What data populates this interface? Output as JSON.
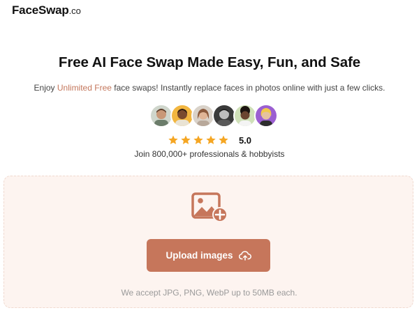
{
  "header": {
    "logo_main": "FaceSwap",
    "logo_tld": ".co"
  },
  "hero": {
    "title": "Free AI Face Swap Made Easy, Fun, and Safe",
    "subtitle_pre": "Enjoy ",
    "subtitle_accent": "Unlimited Free",
    "subtitle_post": " face swaps! Instantly replace faces in photos online with just a few clicks.",
    "accent_color": "#c4775c"
  },
  "social_proof": {
    "avatars": [
      {
        "name": "avatar-1",
        "bg": "#cfd6cc"
      },
      {
        "name": "avatar-2",
        "bg": "#f2b640"
      },
      {
        "name": "avatar-3",
        "bg": "#d9d2c9"
      },
      {
        "name": "avatar-4",
        "bg": "#3a3a3a"
      },
      {
        "name": "avatar-5",
        "bg": "#cfe0b8"
      },
      {
        "name": "avatar-6",
        "bg": "#9b5fd1"
      }
    ],
    "star_count": 5,
    "star_color": "#f5a623",
    "rating": "5.0",
    "join_text": "Join 800,000+ professionals & hobbyists"
  },
  "upload": {
    "icon": "image-plus-icon",
    "button_label": "Upload images",
    "button_icon": "cloud-upload-icon",
    "button_color": "#c6765b",
    "accept_text": "We accept JPG, PNG, WebP up to 50MB each."
  }
}
